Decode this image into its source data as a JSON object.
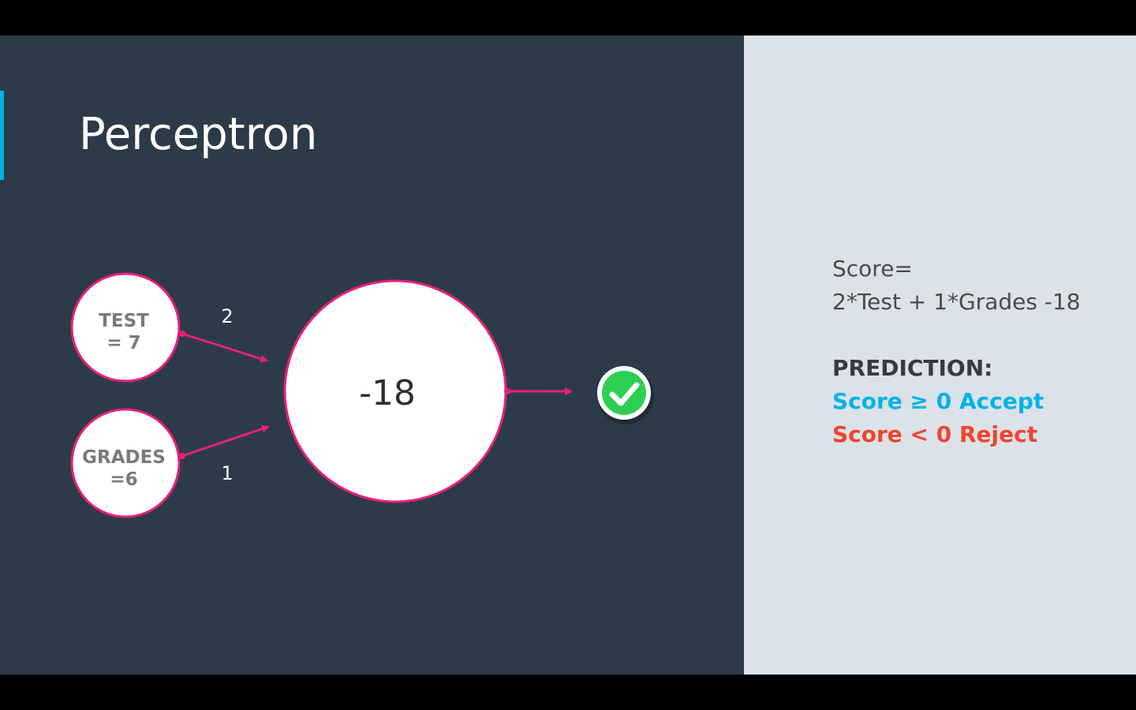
{
  "title": "Perceptron",
  "inputs": [
    {
      "name": "TEST",
      "value": "= 7"
    },
    {
      "name": "GRADES",
      "value": "=6"
    }
  ],
  "weights": [
    "2",
    "1"
  ],
  "node_value": "-18",
  "output_icon": "check-circle-icon",
  "formula": {
    "line1": "Score=",
    "line2": "2*Test + 1*Grades -18"
  },
  "prediction": {
    "heading": "PREDICTION:",
    "accept": "Score ≥ 0 Accept",
    "reject": "Score < 0 Reject"
  },
  "colors": {
    "background_dark": "#2d3b48",
    "panel_light": "#dbe2e8",
    "accent_blue": "#02b3e4",
    "node_border": "#ea1f7a",
    "accept": "#02b3e4",
    "reject": "#f0442d",
    "check_green": "#2ccf52"
  }
}
